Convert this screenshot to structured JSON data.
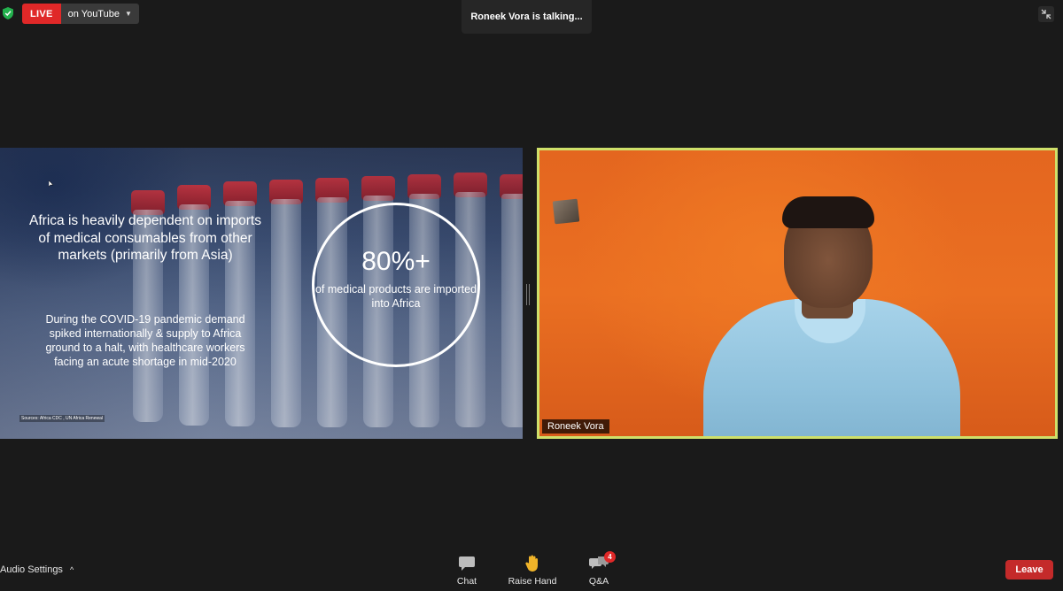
{
  "top_bar": {
    "live_badge": "LIVE",
    "live_platform": "on YouTube",
    "talking_indicator": "Roneek Vora is talking..."
  },
  "slide": {
    "heading": "Africa is heavily dependent on imports of medical consumables from other markets (primarily from Asia)",
    "body": "During the COVID-19 pandemic demand spiked internationally & supply to Africa ground to a halt, with healthcare workers facing an acute shortage in mid-2020",
    "stat_value": "80%+",
    "stat_description": "of medical products are imported into Africa",
    "source": "Sources: Africa CDC , UN Africa Renewal"
  },
  "video": {
    "participant_name": "Roneek Vora"
  },
  "toolbar": {
    "audio_settings": "Audio Settings",
    "chat": "Chat",
    "raise_hand": "Raise Hand",
    "qa": "Q&A",
    "qa_badge": "4",
    "leave": "Leave"
  },
  "colors": {
    "live_red": "#e02828",
    "leave_red": "#c42a2a",
    "active_speaker_border": "#cfe06a",
    "background": "#1a1a1a"
  },
  "icons": [
    "shield-check-icon",
    "caret-down-icon",
    "exit-fullscreen-icon",
    "chevron-up-icon",
    "chat-icon",
    "raise-hand-icon",
    "qa-icon"
  ]
}
